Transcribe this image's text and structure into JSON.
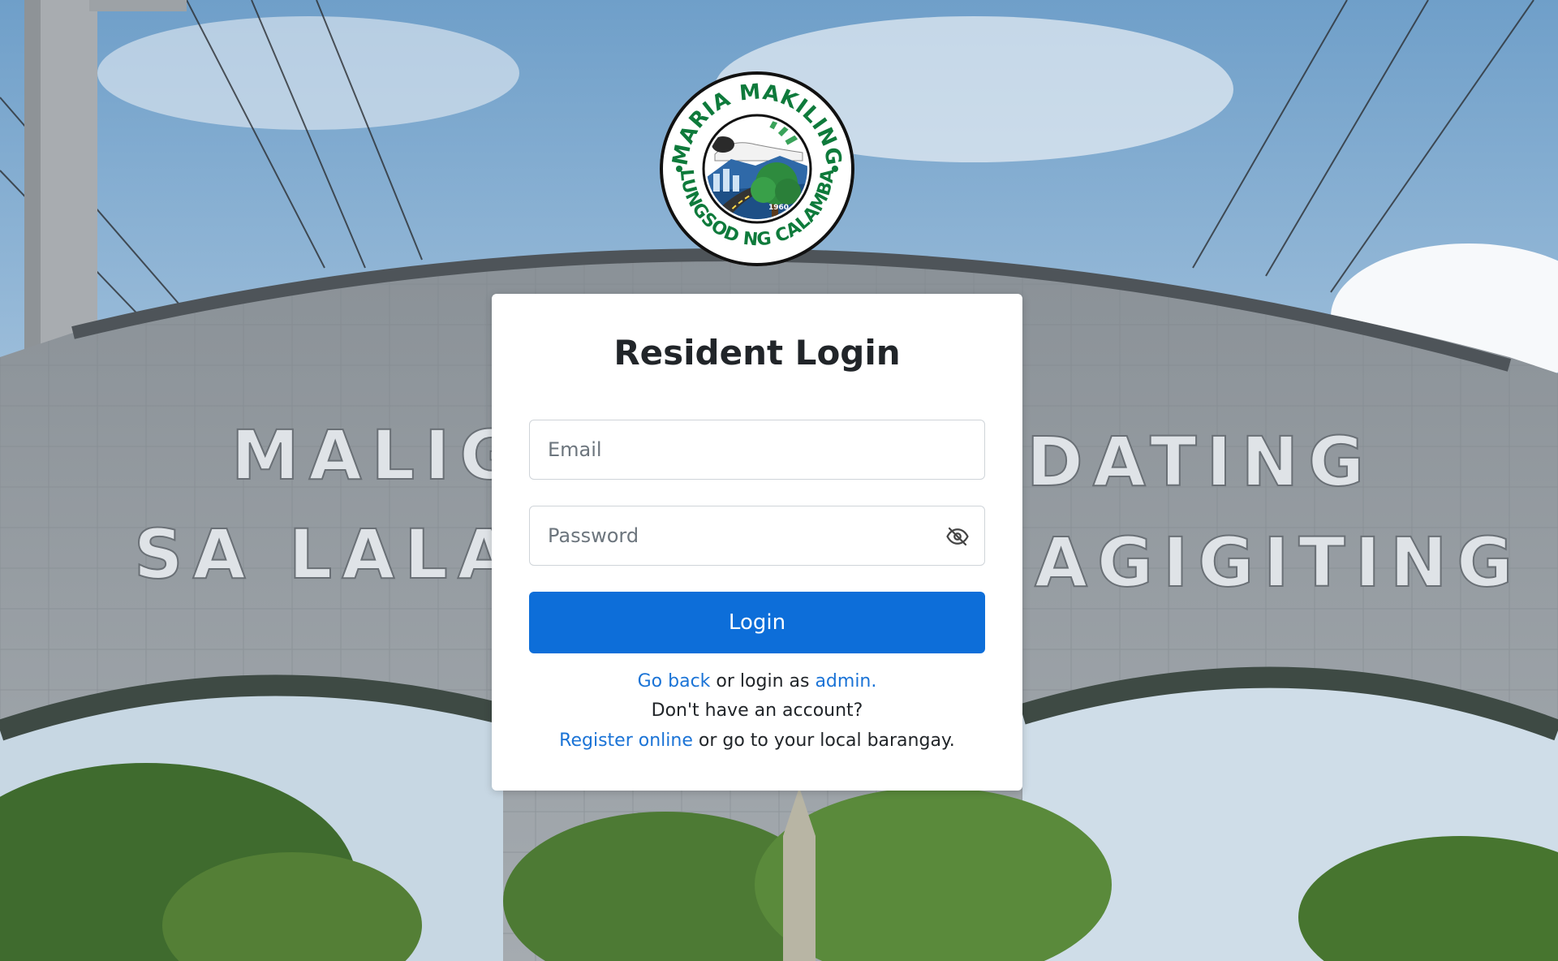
{
  "logo": {
    "top_text": "MARIA MAKILING",
    "bottom_text": "LUNGSOD NG CALAMBA",
    "year": "1960"
  },
  "background": {
    "arch_line1_left": "MALIG",
    "arch_line1_right": "DATING",
    "arch_line2_left": "SA LALA",
    "arch_line2_right": "AGIGITING"
  },
  "form": {
    "title": "Resident Login",
    "email_placeholder": "Email",
    "password_placeholder": "Password",
    "password_toggle_icon": "eye-slash-icon",
    "login_label": "Login"
  },
  "links": {
    "go_back": "Go back",
    "or_login_as": " or login as ",
    "admin": "admin.",
    "no_account": "Don't have an account?",
    "register_online": "Register online",
    "or_go_local": " or go to your local barangay."
  },
  "colors": {
    "primary": "#0d6ed9",
    "link": "#1a73d6",
    "logo_green": "#0e7a3b"
  }
}
